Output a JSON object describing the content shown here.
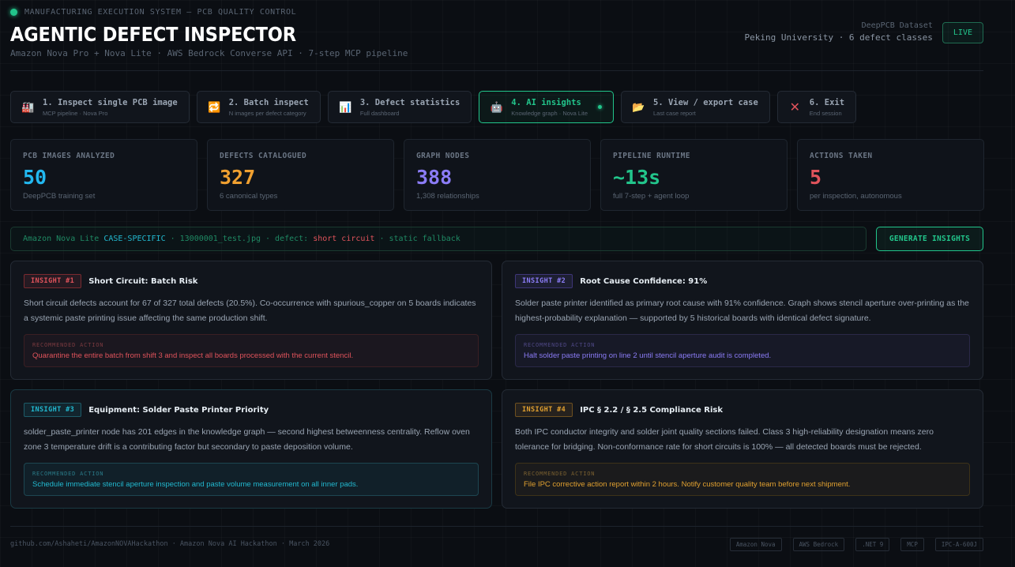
{
  "header": {
    "system_label": "MANUFACTURING EXECUTION SYSTEM — PCB QUALITY CONTROL",
    "title": "AGENTIC DEFECT INSPECTOR",
    "subtitle": "Amazon Nova Pro + Nova Lite · AWS Bedrock Converse API · 7-step MCP pipeline",
    "dataset_label": "DeepPCB Dataset",
    "dataset_value": "Peking University · 6 defect classes",
    "live_label": "LIVE"
  },
  "menu": {
    "items": [
      {
        "label": "1. Inspect single PCB image",
        "sub": "MCP pipeline · Nova Pro",
        "icon": "factory-icon",
        "glyph": "🏭"
      },
      {
        "label": "2. Batch inspect",
        "sub": "N images per defect category",
        "icon": "repeat-icon",
        "glyph": "🔁"
      },
      {
        "label": "3. Defect statistics",
        "sub": "Full dashboard",
        "icon": "bar-chart-icon",
        "glyph": "📊"
      },
      {
        "label": "4. AI insights",
        "sub": "Knowledge graph · Nova Lite",
        "icon": "robot-icon",
        "glyph": "🤖"
      },
      {
        "label": "5. View / export case",
        "sub": "Last case report",
        "icon": "folder-icon",
        "glyph": "📂"
      },
      {
        "label": "6. Exit",
        "sub": "End session",
        "icon": "close-icon",
        "glyph": "✕"
      }
    ],
    "active_index": 3
  },
  "stats": [
    {
      "label": "PCB IMAGES ANALYZED",
      "value": "50",
      "sub": "DeepPCB training set",
      "color": "#22b8f0"
    },
    {
      "label": "DEFECTS CATALOGUED",
      "value": "327",
      "sub": "6 canonical types",
      "color": "#f0a030"
    },
    {
      "label": "GRAPH NODES",
      "value": "388",
      "sub": "1,308 relationships",
      "color": "#8b7cf6"
    },
    {
      "label": "PIPELINE RUNTIME",
      "value": "~13s",
      "sub": "full 7-step + agent loop",
      "color": "#22c58b"
    },
    {
      "label": "ACTIONS TAKEN",
      "value": "5",
      "sub": "per inspection, autonomous",
      "color": "#e0535b"
    }
  ],
  "context": {
    "model": "Amazon Nova Lite",
    "mode": "CASE-SPECIFIC",
    "sep1": "·",
    "file": "13000001_test.jpg",
    "sep2": "·",
    "defect_label": "defect:",
    "defect_value": "short circuit",
    "sep3": "·",
    "fallback": "static fallback"
  },
  "generate_label": "GENERATE INSIGHTS",
  "insights": [
    {
      "badge": "INSIGHT #1",
      "title": "Short Circuit: Batch Risk",
      "body": "Short circuit defects account for 67 of 327 total defects (20.5%). Co-occurrence with spurious_copper on 5 boards indicates a systemic paste printing issue affecting the same production shift.",
      "action_label": "RECOMMENDED ACTION",
      "action": "Quarantine the entire batch from shift 3 and inspect all boards processed with the current stencil."
    },
    {
      "badge": "INSIGHT #2",
      "title": "Root Cause Confidence: 91%",
      "body": "Solder paste printer identified as primary root cause with 91% confidence. Graph shows stencil aperture over-printing as the highest-probability explanation — supported by 5 historical boards with identical defect signature.",
      "action_label": "RECOMMENDED ACTION",
      "action": "Halt solder paste printing on line 2 until stencil aperture audit is completed."
    },
    {
      "badge": "INSIGHT #3",
      "title": "Equipment: Solder Paste Printer Priority",
      "body": "solder_paste_printer node has 201 edges in the knowledge graph — second highest betweenness centrality. Reflow oven zone 3 temperature drift is a contributing factor but secondary to paste deposition volume.",
      "action_label": "RECOMMENDED ACTION",
      "action": "Schedule immediate stencil aperture inspection and paste volume measurement on all inner pads."
    },
    {
      "badge": "INSIGHT #4",
      "title": "IPC § 2.2 / § 2.5 Compliance Risk",
      "body": "Both IPC conductor integrity and solder joint quality sections failed. Class 3 high-reliability designation means zero tolerance for bridging. Non-conformance rate for short circuits is 100% — all detected boards must be rejected.",
      "action_label": "RECOMMENDED ACTION",
      "action": "File IPC corrective action report within 2 hours. Notify customer quality team before next shipment."
    }
  ],
  "footer": {
    "text": "github.com/Ashaheti/AmazonNOVAHackathon · Amazon Nova AI Hackathon · March 2026",
    "tags": [
      "Amazon Nova",
      "AWS Bedrock",
      ".NET 9",
      "MCP",
      "IPC-A-600J"
    ]
  }
}
